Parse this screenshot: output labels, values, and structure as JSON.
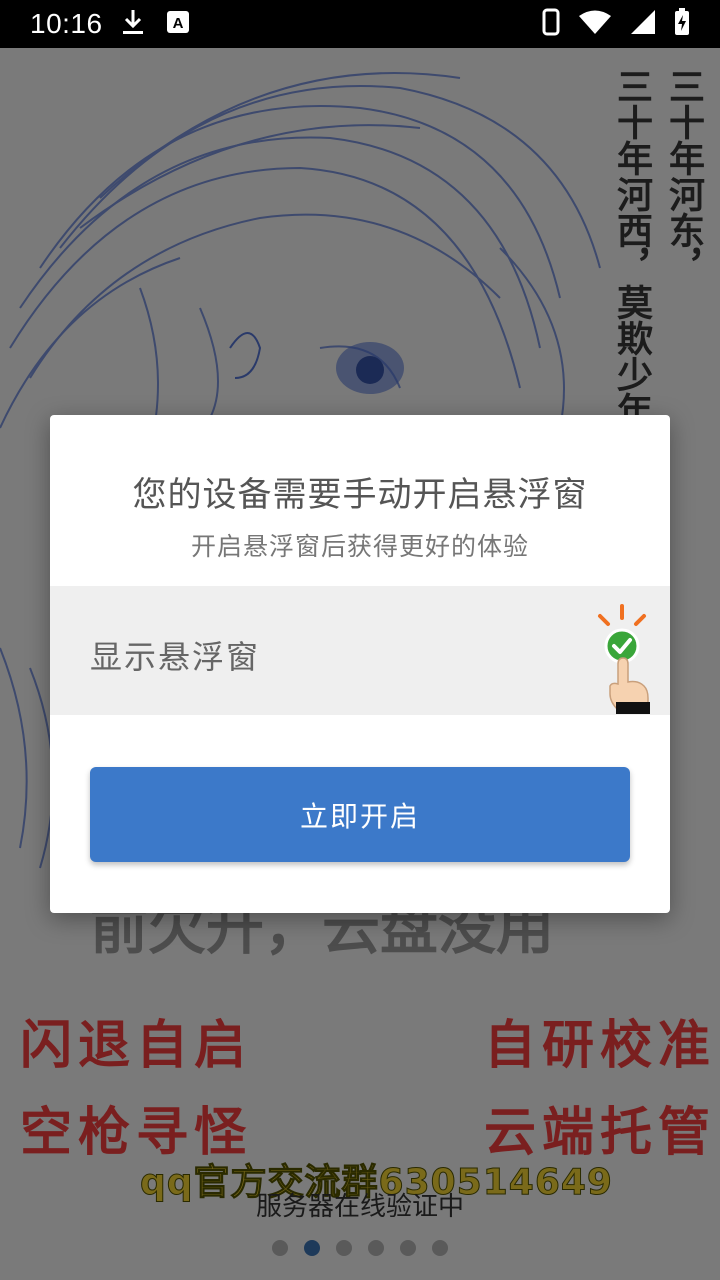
{
  "status_bar": {
    "time": "10:16",
    "left_icons": [
      "download-icon",
      "a-badge-icon"
    ],
    "right_icons": [
      "phone-icon",
      "wifi-icon",
      "signal-icon",
      "battery-charging-icon"
    ]
  },
  "background": {
    "poem_col1": "三十年河东，",
    "poem_col2": "三十年河西，莫欺少年",
    "slogans": [
      "闪退自启",
      "自研校准",
      "空枪寻怪",
      "云端托管"
    ],
    "qq_group": "qq官方交流群630514649",
    "verify_text": "服务器在线验证中",
    "pager_dots": 6,
    "active_dot": 1
  },
  "dialog": {
    "title": "您的设备需要手动开启悬浮窗",
    "subtitle": "开启悬浮窗后获得更好的体验",
    "permission_label": "显示悬浮窗",
    "enable_button": "立即开启"
  },
  "colors": {
    "accent": "#3c79c9",
    "check_green": "#3aa63a",
    "spark_orange": "#f07020"
  }
}
